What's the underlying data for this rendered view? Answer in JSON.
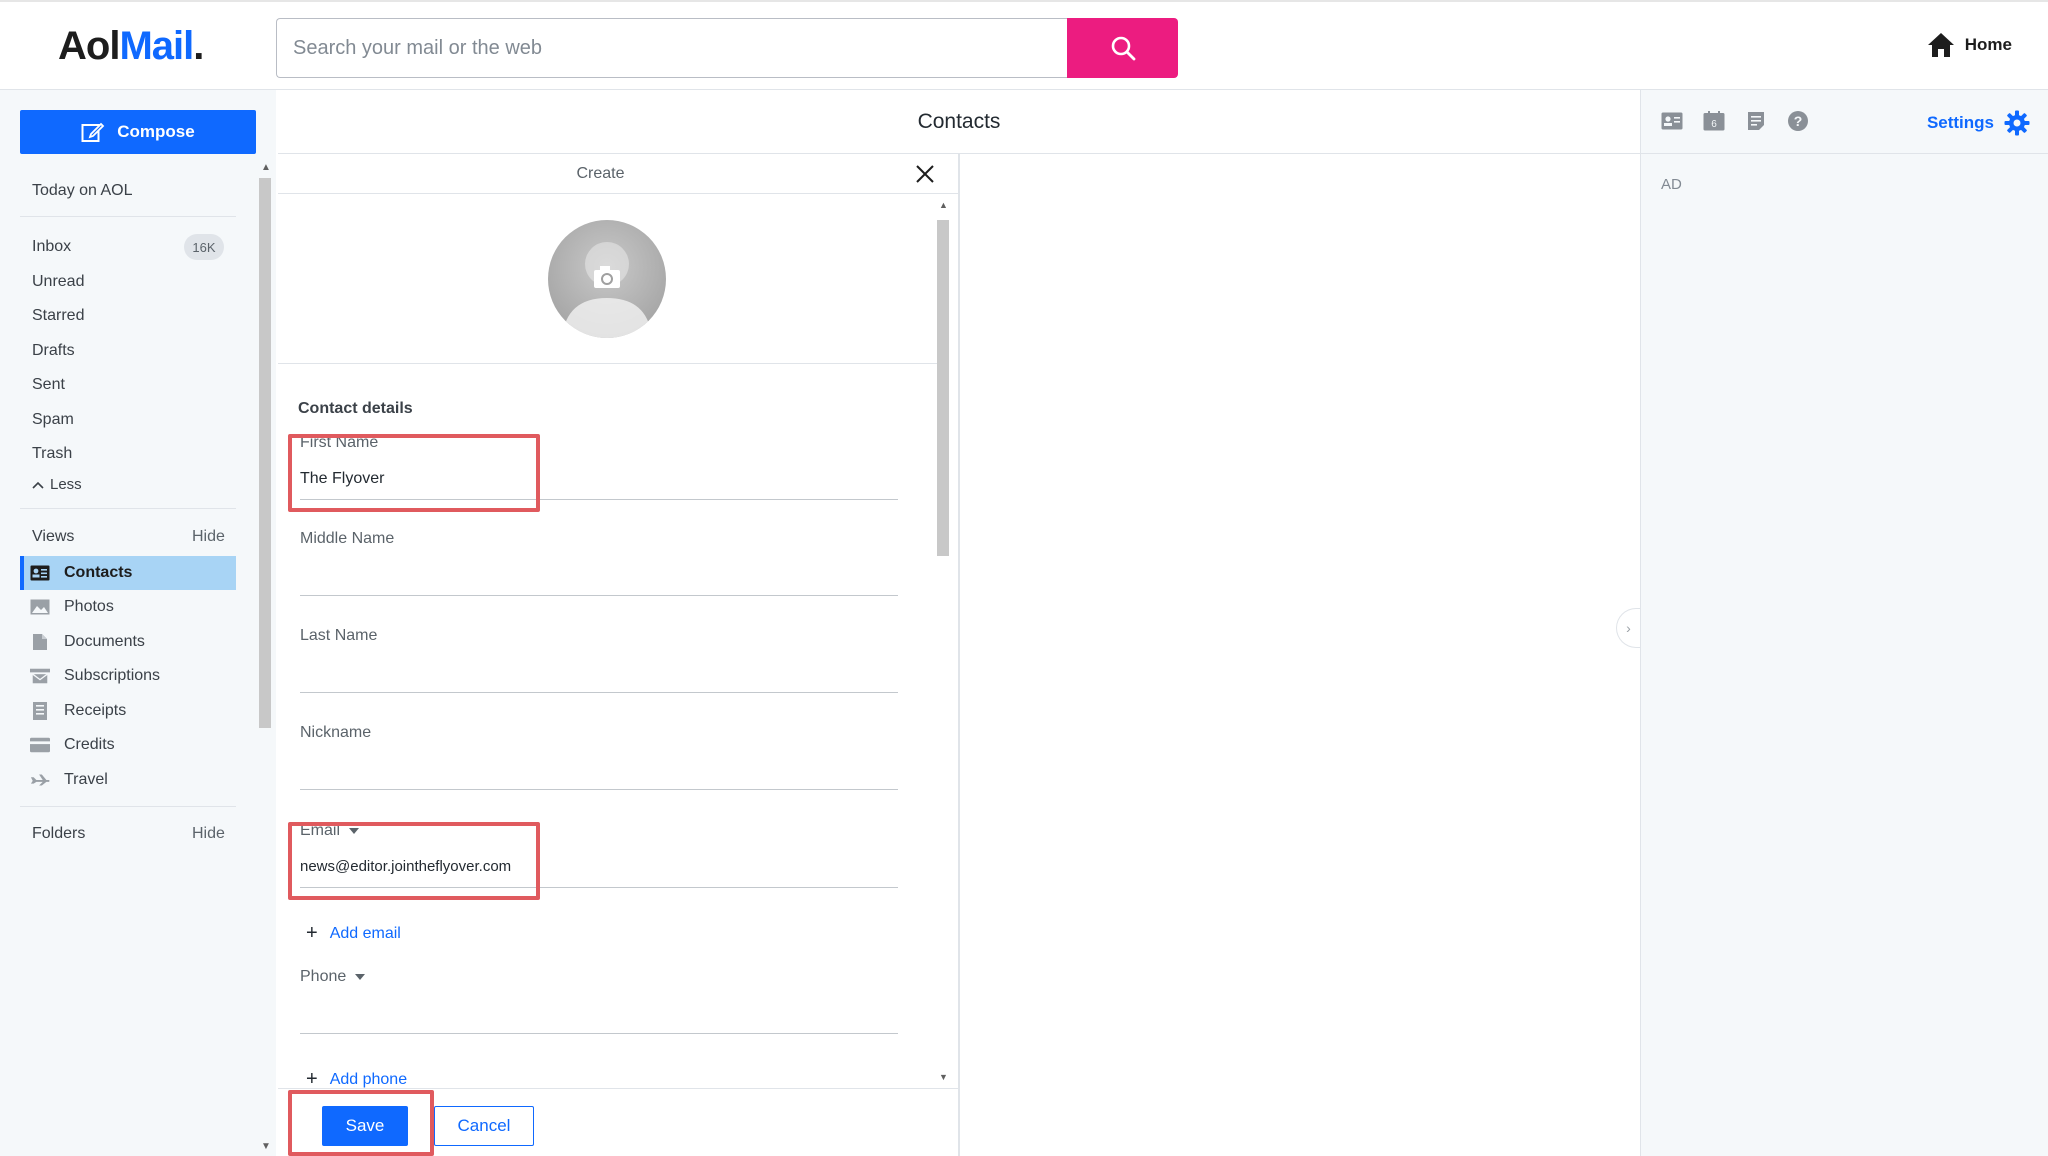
{
  "header": {
    "logo_aol": "Aol",
    "logo_mail": "Mail",
    "logo_dot": ".",
    "search_placeholder": "Search your mail or the web",
    "home_label": "Home"
  },
  "sidebar": {
    "compose_label": "Compose",
    "today": "Today on AOL",
    "folders": [
      {
        "label": "Inbox",
        "badge": "16K"
      },
      {
        "label": "Unread"
      },
      {
        "label": "Starred"
      },
      {
        "label": "Drafts"
      },
      {
        "label": "Sent"
      },
      {
        "label": "Spam"
      },
      {
        "label": "Trash"
      }
    ],
    "less_label": "Less",
    "views_label": "Views",
    "views_hide": "Hide",
    "views": [
      {
        "label": "Contacts",
        "icon": "contacts-icon",
        "active": true
      },
      {
        "label": "Photos",
        "icon": "photos-icon"
      },
      {
        "label": "Documents",
        "icon": "documents-icon"
      },
      {
        "label": "Subscriptions",
        "icon": "subscriptions-icon"
      },
      {
        "label": "Receipts",
        "icon": "receipts-icon"
      },
      {
        "label": "Credits",
        "icon": "credits-icon"
      },
      {
        "label": "Travel",
        "icon": "travel-icon"
      }
    ],
    "folders_label": "Folders",
    "folders_hide": "Hide"
  },
  "contacts": {
    "title": "Contacts",
    "create_label": "Create",
    "details_title": "Contact details",
    "fields": {
      "first_name": {
        "label": "First Name",
        "value": "The Flyover"
      },
      "middle_name": {
        "label": "Middle Name",
        "value": ""
      },
      "last_name": {
        "label": "Last Name",
        "value": ""
      },
      "nickname": {
        "label": "Nickname",
        "value": ""
      },
      "email": {
        "label": "Email",
        "value": "news@editor.jointheflyover.com"
      },
      "phone": {
        "label": "Phone",
        "value": ""
      }
    },
    "add_email": "Add email",
    "add_phone": "Add phone",
    "save": "Save",
    "cancel": "Cancel"
  },
  "rail": {
    "calendar_day": "6",
    "settings_label": "Settings",
    "ad_label": "AD"
  },
  "colors": {
    "accent": "#0f69ff",
    "search_button": "#ec1c80",
    "highlight": "#e05a5e",
    "active_view": "#a8d4f5"
  }
}
